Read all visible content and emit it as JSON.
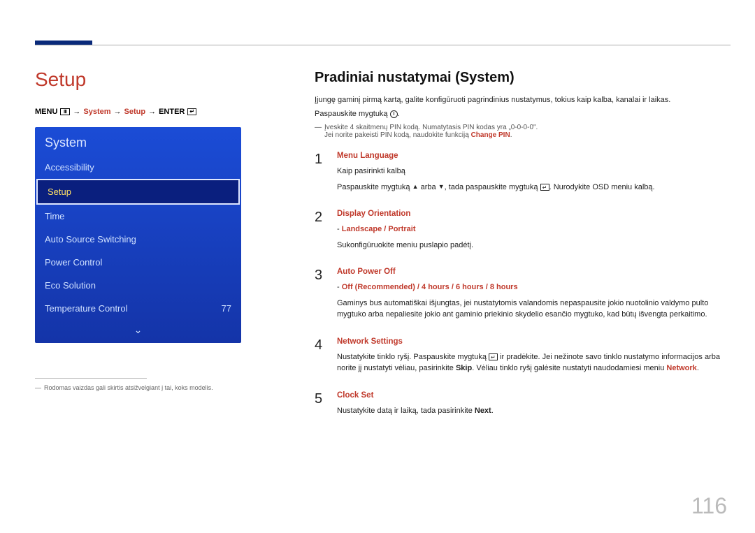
{
  "page_number": "116",
  "left": {
    "title": "Setup",
    "breadcrumb": {
      "menu": "MENU",
      "arrow": "→",
      "system": "System",
      "setup": "Setup",
      "enter": "ENTER"
    },
    "menu": {
      "header": "System",
      "items": [
        {
          "label": "Accessibility",
          "value": ""
        },
        {
          "label": "Setup",
          "value": ""
        },
        {
          "label": "Time",
          "value": ""
        },
        {
          "label": "Auto Source Switching",
          "value": ""
        },
        {
          "label": "Power Control",
          "value": ""
        },
        {
          "label": "Eco Solution",
          "value": ""
        },
        {
          "label": "Temperature Control",
          "value": "77"
        }
      ]
    },
    "footnote_dash": "―",
    "footnote": "Rodomas vaizdas gali skirtis atsižvelgiant į tai, koks modelis."
  },
  "right": {
    "heading": "Pradiniai nustatymai (System)",
    "intro": "Įjungę gaminį pirmą kartą, galite konfigūruoti pagrindinius nustatymus, tokius kaip kalba, kanalai ir laikas.",
    "press": "Paspauskite mygtuką ",
    "press_suffix": ".",
    "pin_dash": "―",
    "pin_line": "Įveskite 4 skaitmenų PIN kodą. Numatytasis PIN kodas yra „0-0-0-0\".",
    "pin_change_prefix": "Jei norite pakeisti PIN kodą, naudokite funkciją ",
    "pin_change_red": "Change PIN",
    "pin_change_suffix": ".",
    "steps": [
      {
        "num": "1",
        "title": "Menu Language",
        "lines": [
          {
            "t": "plain",
            "text": "Kaip pasirinkti kalbą"
          },
          {
            "t": "press_osd",
            "p1": "Paspauskite mygtuką ",
            "or": " arba ",
            "p2": ", tada paspauskite mygtuką ",
            "suffix": ". Nurodykite OSD meniu kalbą."
          }
        ]
      },
      {
        "num": "2",
        "title": "Display Orientation",
        "lines": [
          {
            "t": "opts",
            "dash": "-",
            "opts": [
              "Landscape",
              "Portrait"
            ],
            "sep": " / "
          },
          {
            "t": "plain",
            "text": "Sukonfigūruokite meniu puslapio padėtį."
          }
        ]
      },
      {
        "num": "3",
        "title": "Auto Power Off",
        "lines": [
          {
            "t": "opts",
            "dash": "-",
            "opts": [
              "Off (Recommended)",
              "4 hours",
              "6 hours",
              "8 hours"
            ],
            "sep": " / "
          },
          {
            "t": "plain",
            "text": "Gaminys bus automatiškai išjungtas, jei nustatytomis valandomis nepaspausite jokio nuotolinio valdymo pulto mygtuko arba nepaliesite jokio ant gaminio priekinio skydelio esančio mygtuko, kad būtų išvengta perkaitimo."
          }
        ]
      },
      {
        "num": "4",
        "title": "Network Settings",
        "lines": [
          {
            "t": "net",
            "p1": "Nustatykite tinklo ryšį. Paspauskite mygtuką ",
            "p2": " ir pradėkite. Jei nežinote savo tinklo nustatymo informacijos arba norite jį nustatyti vėliau, pasirinkite ",
            "skip": "Skip",
            "p3": ". Vėliau tinklo ryšį galėsite nustatyti naudodamiesi meniu ",
            "network": "Network",
            "p4": "."
          }
        ]
      },
      {
        "num": "5",
        "title": "Clock Set",
        "lines": [
          {
            "t": "clock",
            "p1": "Nustatykite datą ir laiką, tada pasirinkite ",
            "next": "Next",
            "p2": "."
          }
        ]
      }
    ]
  }
}
